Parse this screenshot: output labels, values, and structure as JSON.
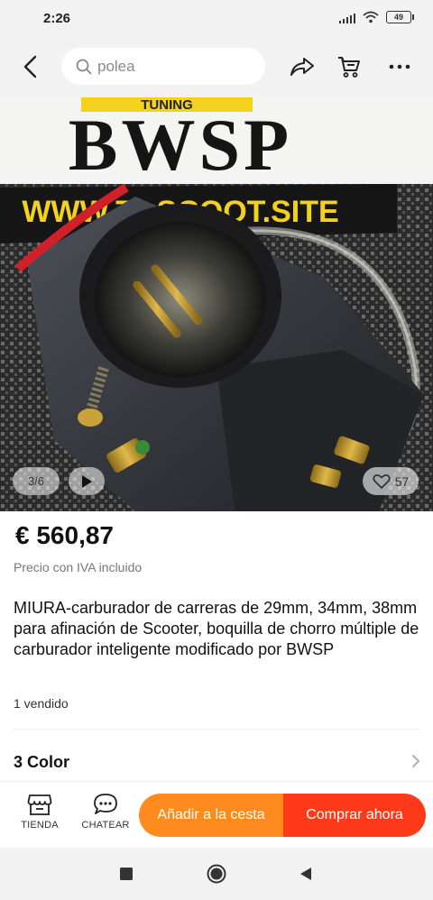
{
  "status_bar": {
    "time": "2:26",
    "battery": "49"
  },
  "search": {
    "placeholder": "polea"
  },
  "product_image": {
    "counter": "3/6",
    "likes": "57",
    "sign_brand": "BWSP",
    "sign_banner": "TUNING",
    "sign_url": "WWW.T...SCOOT.SITE"
  },
  "product": {
    "price": "€ 560,87",
    "tax_note": "Precio con IVA incluido",
    "title": "MIURA-carburador de carreras de 29mm, 34mm, 38mm para afinación de Scooter, boquilla de chorro múltiple de carburador inteligente modificado por BWSP",
    "sold": "1 vendido",
    "color_option": "3 Color"
  },
  "action_bar": {
    "store_label": "TIENDA",
    "chat_label": "CHATEAR",
    "add_to_cart": "Añadir a la cesta",
    "buy_now": "Comprar ahora"
  },
  "colors": {
    "orange": "#ff8a1e",
    "red_orange": "#ff3a1a",
    "background_bar": "#f2f2f2"
  },
  "icons": [
    "back-arrow-icon",
    "search-icon",
    "share-icon",
    "cart-icon",
    "more-icon",
    "play-icon",
    "heart-icon",
    "chevron-right-icon",
    "store-icon",
    "chat-icon",
    "recents-icon",
    "home-icon",
    "back-icon"
  ]
}
